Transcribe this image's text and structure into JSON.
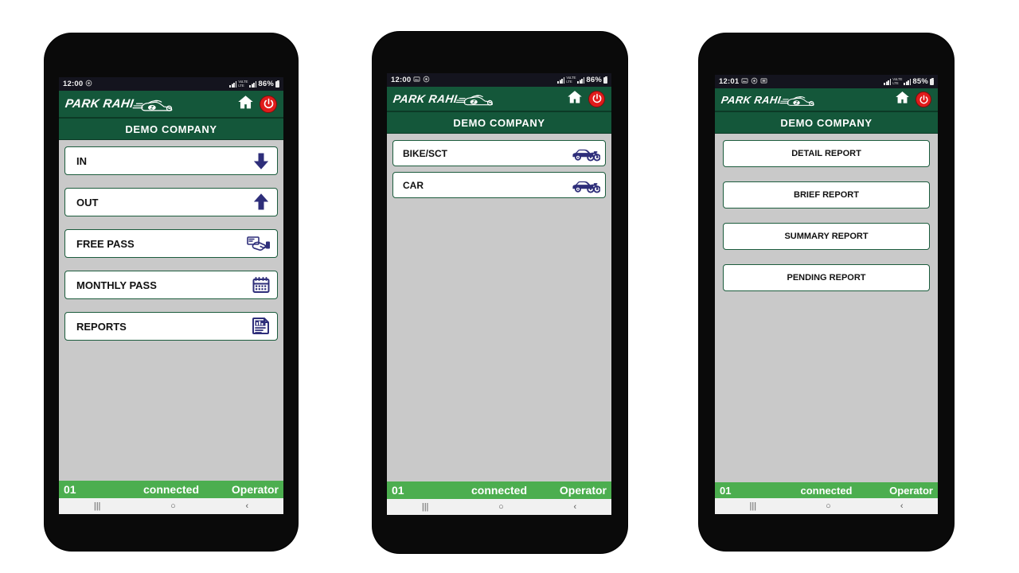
{
  "theme": {
    "header_green": "#14573a",
    "status_green": "#4cae4f",
    "screen_bg": "#c9c9c9",
    "button_border": "#1c5c3d",
    "icon_navy": "#2e2e7a",
    "power_red": "#e01b1b",
    "sysbar_dark": "#14141e"
  },
  "app": {
    "logo_text": "PARK RAHI",
    "company_title": "DEMO COMPANY",
    "home_icon": "home-icon",
    "power_icon": "power-icon"
  },
  "status_bar_app": {
    "counter": "01",
    "connection": "connected",
    "role": "Operator"
  },
  "nav_bar": {
    "recents": "|||",
    "home": "○",
    "back": "‹"
  },
  "phones": [
    {
      "id": "phone-main-menu",
      "system": {
        "time": "12:00",
        "battery": "86%",
        "notif_icons": [
          "alarm-icon"
        ],
        "network": "LTE"
      },
      "buttons": [
        {
          "label": "IN",
          "icon": "arrow-down-icon",
          "align": "left"
        },
        {
          "label": "OUT",
          "icon": "arrow-up-icon",
          "align": "left"
        },
        {
          "label": "FREE PASS",
          "icon": "free-pass-icon",
          "align": "left"
        },
        {
          "label": "MONTHLY PASS",
          "icon": "calendar-icon",
          "align": "left"
        },
        {
          "label": "REPORTS",
          "icon": "report-doc-icon",
          "align": "left"
        }
      ]
    },
    {
      "id": "phone-vehicle-type",
      "system": {
        "time": "12:00",
        "battery": "86%",
        "notif_icons": [
          "gallery-icon",
          "alarm-icon"
        ],
        "network": "LTE"
      },
      "buttons": [
        {
          "label": "BIKE/SCT",
          "icon": "car-bike-icon",
          "align": "left"
        },
        {
          "label": "CAR",
          "icon": "car-bike-icon",
          "align": "left"
        }
      ]
    },
    {
      "id": "phone-reports",
      "system": {
        "time": "12:01",
        "battery": "85%",
        "notif_icons": [
          "gallery-icon",
          "alarm-icon",
          "saved-icon"
        ],
        "network": "LTE"
      },
      "buttons": [
        {
          "label": "DETAIL REPORT",
          "icon": "",
          "align": "center"
        },
        {
          "label": "BRIEF REPORT",
          "icon": "",
          "align": "center"
        },
        {
          "label": "SUMMARY REPORT",
          "icon": "",
          "align": "center"
        },
        {
          "label": "PENDING REPORT",
          "icon": "",
          "align": "center"
        }
      ]
    }
  ]
}
